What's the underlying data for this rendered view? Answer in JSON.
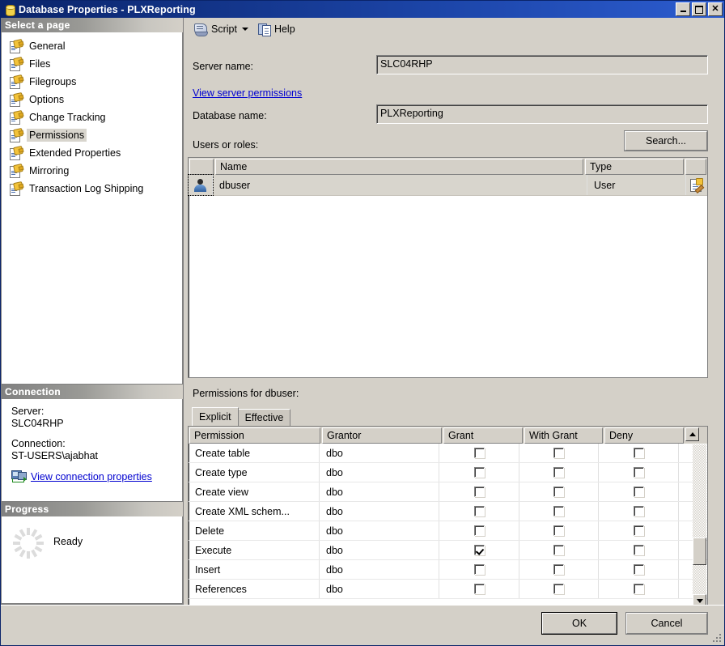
{
  "window": {
    "title": "Database Properties - PLXReporting",
    "icon": "database-icon",
    "minimize_label": "Minimize",
    "maximize_label": "Maximize",
    "close_label": "Close"
  },
  "sidebar": {
    "header": "Select a page",
    "items": [
      {
        "label": "General",
        "icon": "page-icon",
        "selected": false
      },
      {
        "label": "Files",
        "icon": "page-icon",
        "selected": false
      },
      {
        "label": "Filegroups",
        "icon": "page-icon",
        "selected": false
      },
      {
        "label": "Options",
        "icon": "page-icon",
        "selected": false
      },
      {
        "label": "Change Tracking",
        "icon": "page-icon",
        "selected": false
      },
      {
        "label": "Permissions",
        "icon": "page-icon",
        "selected": true
      },
      {
        "label": "Extended Properties",
        "icon": "page-icon",
        "selected": false
      },
      {
        "label": "Mirroring",
        "icon": "page-icon",
        "selected": false
      },
      {
        "label": "Transaction Log Shipping",
        "icon": "page-icon",
        "selected": false
      }
    ]
  },
  "connection": {
    "header": "Connection",
    "server_label": "Server:",
    "server_value": "SLC04RHP",
    "connection_label": "Connection:",
    "connection_value": "ST-USERS\\ajabhat",
    "link_label": "View connection properties",
    "link_icon": "connection-icon"
  },
  "progress": {
    "header": "Progress",
    "status": "Ready",
    "spinner_icon": "spinner-icon"
  },
  "toolbar": {
    "script_label": "Script",
    "script_icon": "script-icon",
    "script_dropdown_icon": "chevron-down-icon",
    "help_label": "Help",
    "help_icon": "help-icon"
  },
  "form": {
    "server_name_label": "Server name:",
    "server_name_value": "SLC04RHP",
    "view_server_permissions_link": "View server permissions",
    "database_name_label": "Database name:",
    "database_name_value": "PLXReporting",
    "users_or_roles_label": "Users or roles:",
    "search_button": "Search..."
  },
  "users_grid": {
    "columns": [
      "",
      "Name",
      "Type",
      ""
    ],
    "rows": [
      {
        "icon": "user-icon",
        "name": "dbuser",
        "type": "User",
        "action_icon": "properties-icon",
        "selected": true
      }
    ]
  },
  "permissions": {
    "caption": "Permissions for dbuser:",
    "tabs": [
      {
        "label": "Explicit",
        "active": true
      },
      {
        "label": "Effective",
        "active": false
      }
    ],
    "columns": [
      "Permission",
      "Grantor",
      "Grant",
      "With Grant",
      "Deny"
    ],
    "rows": [
      {
        "permission": "Create table",
        "grantor": "dbo",
        "grant": false,
        "with_grant": false,
        "deny": false
      },
      {
        "permission": "Create type",
        "grantor": "dbo",
        "grant": false,
        "with_grant": false,
        "deny": false
      },
      {
        "permission": "Create view",
        "grantor": "dbo",
        "grant": false,
        "with_grant": false,
        "deny": false
      },
      {
        "permission": "Create XML schem...",
        "grantor": "dbo",
        "grant": false,
        "with_grant": false,
        "deny": false
      },
      {
        "permission": "Delete",
        "grantor": "dbo",
        "grant": false,
        "with_grant": false,
        "deny": false
      },
      {
        "permission": "Execute",
        "grantor": "dbo",
        "grant": true,
        "with_grant": false,
        "deny": false
      },
      {
        "permission": "Insert",
        "grantor": "dbo",
        "grant": false,
        "with_grant": false,
        "deny": false
      },
      {
        "permission": "References",
        "grantor": "dbo",
        "grant": false,
        "with_grant": false,
        "deny": false
      }
    ],
    "scroll_up_icon": "triangle-up-icon",
    "scroll_down_icon": "triangle-down-icon"
  },
  "footer": {
    "ok_label": "OK",
    "cancel_label": "Cancel"
  },
  "colors": {
    "titlebar_start": "#0a246a",
    "titlebar_end": "#2c5ccf",
    "dialog_face": "#d4d0c8",
    "link": "#0000d0",
    "selection": "#d8d5cd"
  }
}
